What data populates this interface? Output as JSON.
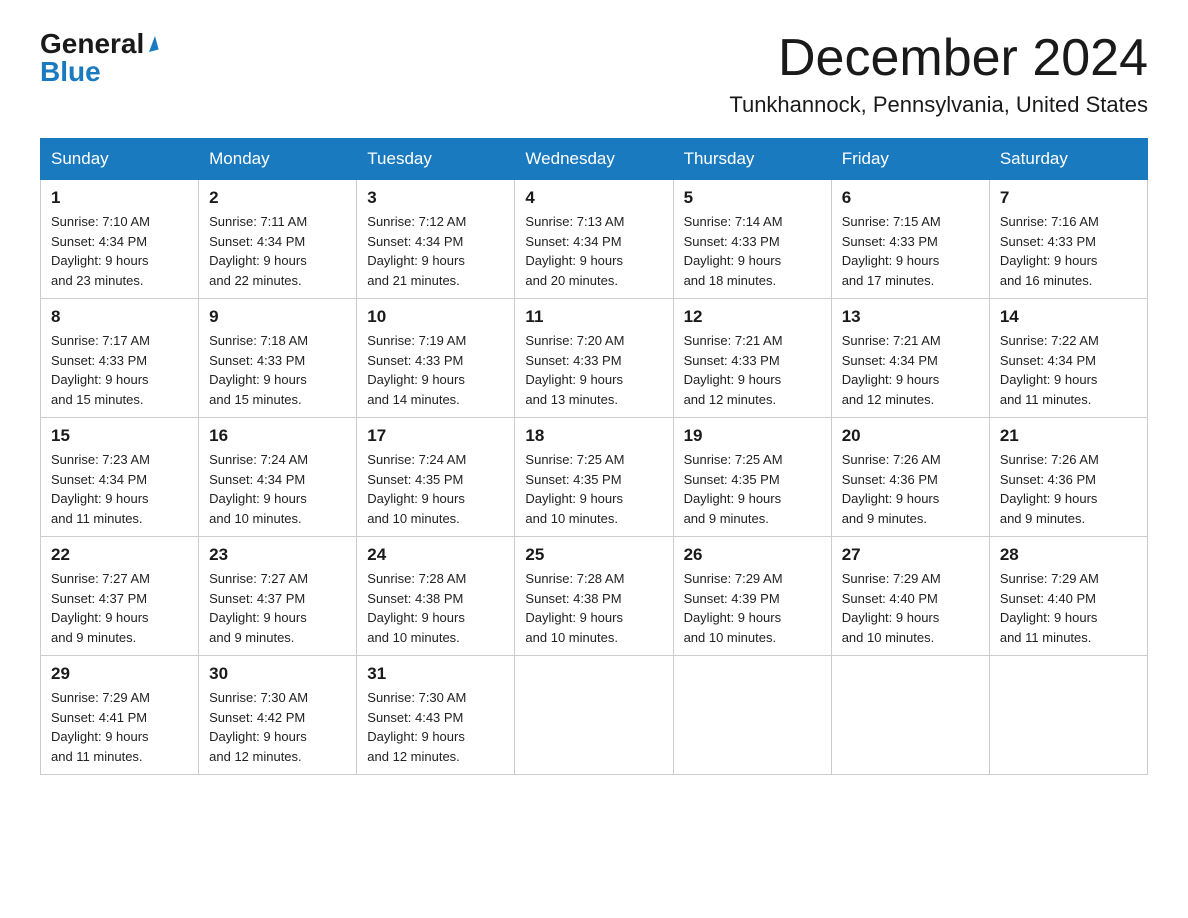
{
  "logo": {
    "general": "General",
    "blue": "Blue"
  },
  "title": {
    "month": "December 2024",
    "location": "Tunkhannock, Pennsylvania, United States"
  },
  "weekdays": [
    "Sunday",
    "Monday",
    "Tuesday",
    "Wednesday",
    "Thursday",
    "Friday",
    "Saturday"
  ],
  "weeks": [
    [
      {
        "day": "1",
        "sunrise": "7:10 AM",
        "sunset": "4:34 PM",
        "daylight": "9 hours and 23 minutes."
      },
      {
        "day": "2",
        "sunrise": "7:11 AM",
        "sunset": "4:34 PM",
        "daylight": "9 hours and 22 minutes."
      },
      {
        "day": "3",
        "sunrise": "7:12 AM",
        "sunset": "4:34 PM",
        "daylight": "9 hours and 21 minutes."
      },
      {
        "day": "4",
        "sunrise": "7:13 AM",
        "sunset": "4:34 PM",
        "daylight": "9 hours and 20 minutes."
      },
      {
        "day": "5",
        "sunrise": "7:14 AM",
        "sunset": "4:33 PM",
        "daylight": "9 hours and 18 minutes."
      },
      {
        "day": "6",
        "sunrise": "7:15 AM",
        "sunset": "4:33 PM",
        "daylight": "9 hours and 17 minutes."
      },
      {
        "day": "7",
        "sunrise": "7:16 AM",
        "sunset": "4:33 PM",
        "daylight": "9 hours and 16 minutes."
      }
    ],
    [
      {
        "day": "8",
        "sunrise": "7:17 AM",
        "sunset": "4:33 PM",
        "daylight": "9 hours and 15 minutes."
      },
      {
        "day": "9",
        "sunrise": "7:18 AM",
        "sunset": "4:33 PM",
        "daylight": "9 hours and 15 minutes."
      },
      {
        "day": "10",
        "sunrise": "7:19 AM",
        "sunset": "4:33 PM",
        "daylight": "9 hours and 14 minutes."
      },
      {
        "day": "11",
        "sunrise": "7:20 AM",
        "sunset": "4:33 PM",
        "daylight": "9 hours and 13 minutes."
      },
      {
        "day": "12",
        "sunrise": "7:21 AM",
        "sunset": "4:33 PM",
        "daylight": "9 hours and 12 minutes."
      },
      {
        "day": "13",
        "sunrise": "7:21 AM",
        "sunset": "4:34 PM",
        "daylight": "9 hours and 12 minutes."
      },
      {
        "day": "14",
        "sunrise": "7:22 AM",
        "sunset": "4:34 PM",
        "daylight": "9 hours and 11 minutes."
      }
    ],
    [
      {
        "day": "15",
        "sunrise": "7:23 AM",
        "sunset": "4:34 PM",
        "daylight": "9 hours and 11 minutes."
      },
      {
        "day": "16",
        "sunrise": "7:24 AM",
        "sunset": "4:34 PM",
        "daylight": "9 hours and 10 minutes."
      },
      {
        "day": "17",
        "sunrise": "7:24 AM",
        "sunset": "4:35 PM",
        "daylight": "9 hours and 10 minutes."
      },
      {
        "day": "18",
        "sunrise": "7:25 AM",
        "sunset": "4:35 PM",
        "daylight": "9 hours and 10 minutes."
      },
      {
        "day": "19",
        "sunrise": "7:25 AM",
        "sunset": "4:35 PM",
        "daylight": "9 hours and 9 minutes."
      },
      {
        "day": "20",
        "sunrise": "7:26 AM",
        "sunset": "4:36 PM",
        "daylight": "9 hours and 9 minutes."
      },
      {
        "day": "21",
        "sunrise": "7:26 AM",
        "sunset": "4:36 PM",
        "daylight": "9 hours and 9 minutes."
      }
    ],
    [
      {
        "day": "22",
        "sunrise": "7:27 AM",
        "sunset": "4:37 PM",
        "daylight": "9 hours and 9 minutes."
      },
      {
        "day": "23",
        "sunrise": "7:27 AM",
        "sunset": "4:37 PM",
        "daylight": "9 hours and 9 minutes."
      },
      {
        "day": "24",
        "sunrise": "7:28 AM",
        "sunset": "4:38 PM",
        "daylight": "9 hours and 10 minutes."
      },
      {
        "day": "25",
        "sunrise": "7:28 AM",
        "sunset": "4:38 PM",
        "daylight": "9 hours and 10 minutes."
      },
      {
        "day": "26",
        "sunrise": "7:29 AM",
        "sunset": "4:39 PM",
        "daylight": "9 hours and 10 minutes."
      },
      {
        "day": "27",
        "sunrise": "7:29 AM",
        "sunset": "4:40 PM",
        "daylight": "9 hours and 10 minutes."
      },
      {
        "day": "28",
        "sunrise": "7:29 AM",
        "sunset": "4:40 PM",
        "daylight": "9 hours and 11 minutes."
      }
    ],
    [
      {
        "day": "29",
        "sunrise": "7:29 AM",
        "sunset": "4:41 PM",
        "daylight": "9 hours and 11 minutes."
      },
      {
        "day": "30",
        "sunrise": "7:30 AM",
        "sunset": "4:42 PM",
        "daylight": "9 hours and 12 minutes."
      },
      {
        "day": "31",
        "sunrise": "7:30 AM",
        "sunset": "4:43 PM",
        "daylight": "9 hours and 12 minutes."
      },
      null,
      null,
      null,
      null
    ]
  ]
}
